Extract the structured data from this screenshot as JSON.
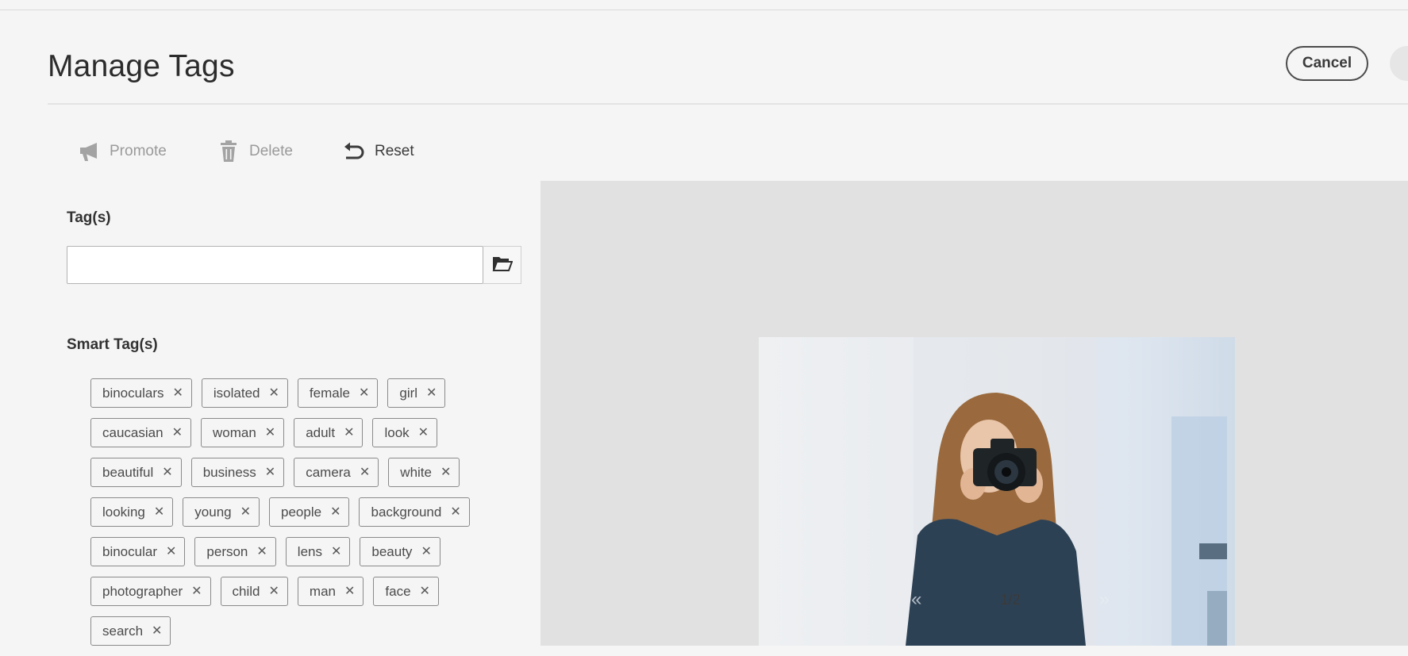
{
  "header": {
    "title": "Manage Tags",
    "cancel_label": "Cancel"
  },
  "toolbar": {
    "promote_label": "Promote",
    "delete_label": "Delete",
    "reset_label": "Reset"
  },
  "form": {
    "tags_label": "Tag(s)",
    "tags_input_value": "",
    "smart_tags_label": "Smart Tag(s)"
  },
  "smart_tags": [
    [
      "binoculars",
      "isolated",
      "female",
      "girl"
    ],
    [
      "caucasian",
      "woman",
      "adult",
      "look"
    ],
    [
      "beautiful",
      "business",
      "camera",
      "white"
    ],
    [
      "looking",
      "young",
      "people",
      "background"
    ],
    [
      "binocular",
      "person",
      "lens",
      "beauty"
    ],
    [
      "photographer",
      "child",
      "man",
      "face"
    ],
    [
      "search"
    ]
  ],
  "preview": {
    "page_indicator": "1/2",
    "prev_icon": "double-chevron-left-icon",
    "next_icon": "double-chevron-right-icon"
  },
  "colors": {
    "page_background": "#f5f5f5",
    "preview_background": "#e1e1e1",
    "tag_border": "#8a8a8a"
  }
}
